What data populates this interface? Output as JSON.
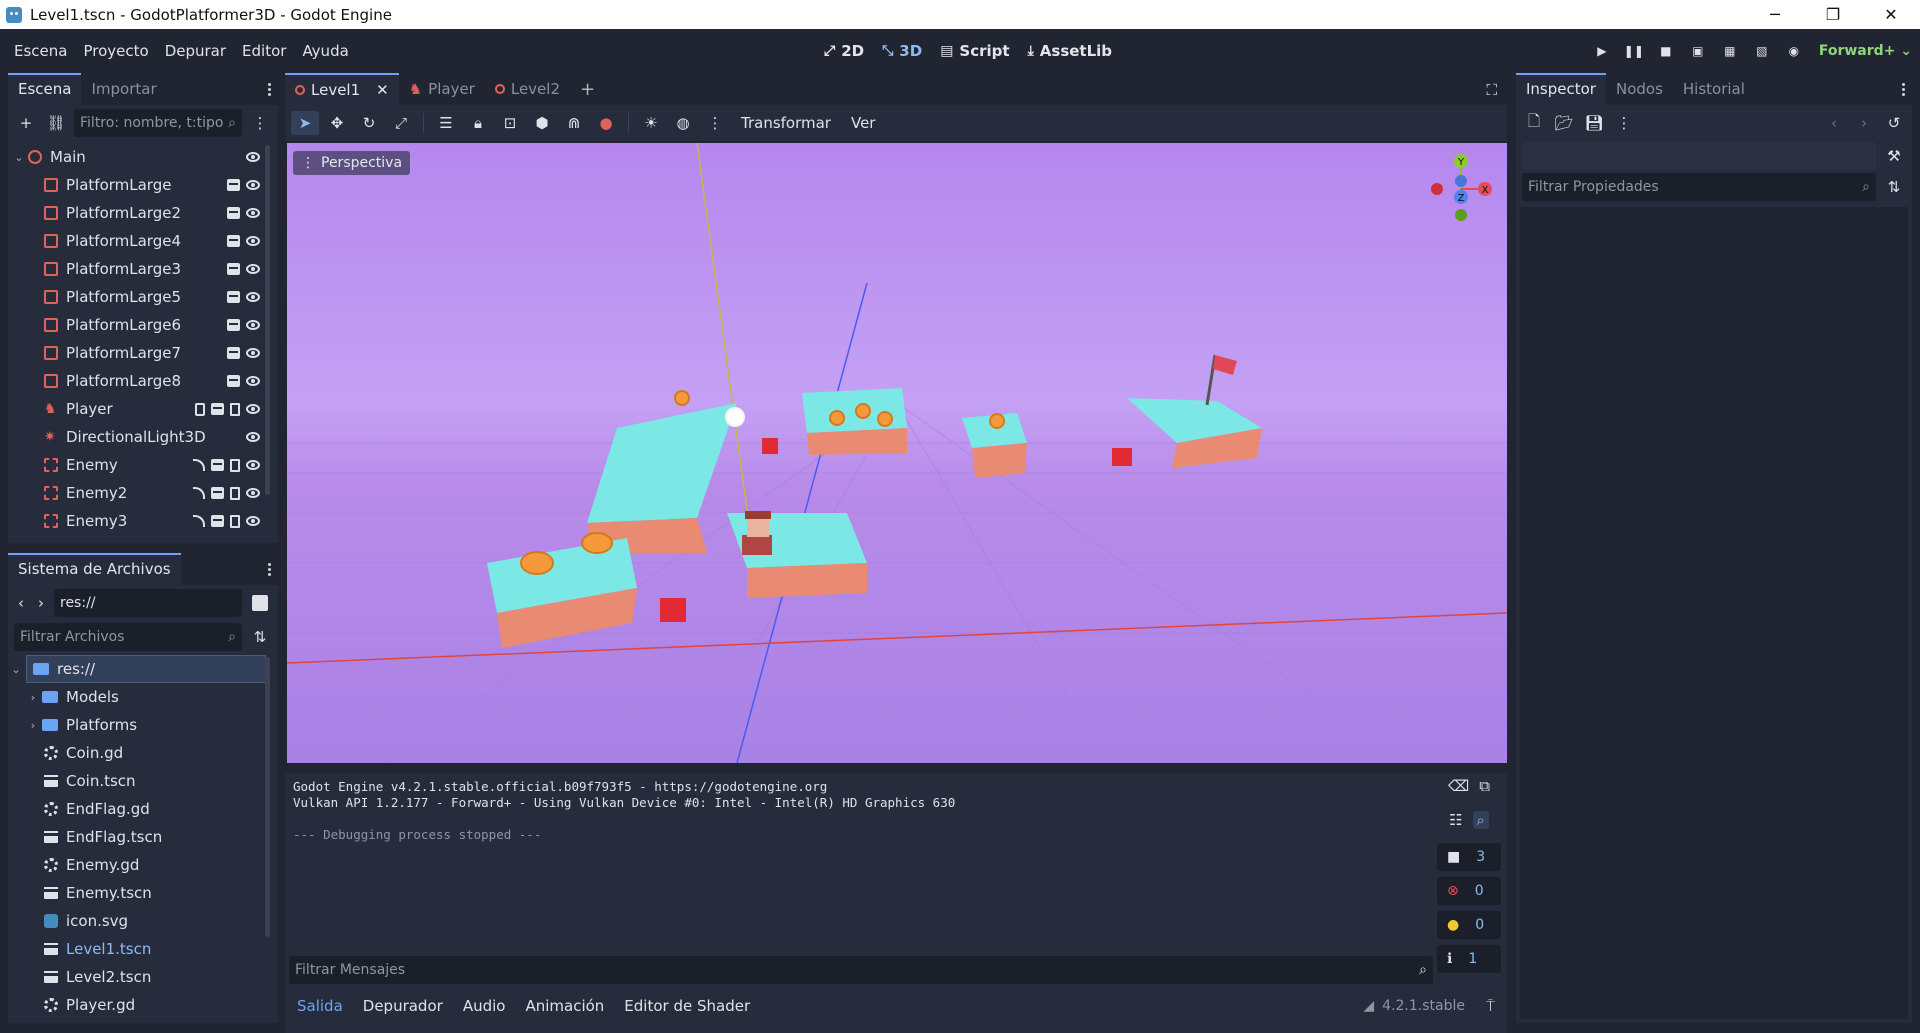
{
  "window": {
    "title": "Level1.tscn - GodotPlatformer3D - Godot Engine",
    "min": "─",
    "max": "❐",
    "close": "✕"
  },
  "menu": [
    "Escena",
    "Proyecto",
    "Depurar",
    "Editor",
    "Ayuda"
  ],
  "workspaces": [
    {
      "label": "2D",
      "icon": "⤢"
    },
    {
      "label": "3D",
      "icon": "⤡"
    },
    {
      "label": "Script",
      "icon": "▤"
    },
    {
      "label": "AssetLib",
      "icon": "⤓"
    }
  ],
  "renderer": "Forward+ ⌄",
  "scene_dock": {
    "tabs": [
      "Escena",
      "Importar"
    ],
    "filter_placeholder": "Filtro: nombre, t:tipo",
    "nodes": [
      {
        "name": "Main",
        "type": "root"
      },
      {
        "name": "PlatformLarge",
        "type": "instance"
      },
      {
        "name": "PlatformLarge2",
        "type": "instance"
      },
      {
        "name": "PlatformLarge4",
        "type": "instance"
      },
      {
        "name": "PlatformLarge3",
        "type": "instance"
      },
      {
        "name": "PlatformLarge5",
        "type": "instance"
      },
      {
        "name": "PlatformLarge6",
        "type": "instance"
      },
      {
        "name": "PlatformLarge7",
        "type": "instance"
      },
      {
        "name": "PlatformLarge8",
        "type": "instance"
      },
      {
        "name": "Player",
        "type": "player"
      },
      {
        "name": "DirectionalLight3D",
        "type": "light"
      },
      {
        "name": "Enemy",
        "type": "enemy"
      },
      {
        "name": "Enemy2",
        "type": "enemy"
      },
      {
        "name": "Enemy3",
        "type": "enemy"
      }
    ]
  },
  "fs_dock": {
    "title": "Sistema de Archivos",
    "path": "res://",
    "filter_placeholder": "Filtrar Archivos",
    "items": [
      {
        "name": "res://",
        "kind": "root"
      },
      {
        "name": "Models",
        "kind": "folder"
      },
      {
        "name": "Platforms",
        "kind": "folder"
      },
      {
        "name": "Coin.gd",
        "kind": "script"
      },
      {
        "name": "Coin.tscn",
        "kind": "scene"
      },
      {
        "name": "EndFlag.gd",
        "kind": "script"
      },
      {
        "name": "EndFlag.tscn",
        "kind": "scene"
      },
      {
        "name": "Enemy.gd",
        "kind": "script"
      },
      {
        "name": "Enemy.tscn",
        "kind": "scene"
      },
      {
        "name": "icon.svg",
        "kind": "svg"
      },
      {
        "name": "Level1.tscn",
        "kind": "scene-active"
      },
      {
        "name": "Level2.tscn",
        "kind": "scene"
      },
      {
        "name": "Player.gd",
        "kind": "script"
      }
    ]
  },
  "scene_tabs": [
    "Level1",
    "Player",
    "Level2"
  ],
  "viewport": {
    "toolbar_labels": [
      "Transformar",
      "Ver"
    ],
    "perspective": "Perspectiva",
    "gizmo": {
      "y": "Y",
      "x": "X",
      "z": "Z"
    },
    "colors": {
      "sky": "#b587ee",
      "platform_top": "#7be8e6",
      "platform_side": "#e98a72"
    }
  },
  "console": {
    "lines": [
      "Godot Engine v4.2.1.stable.official.b09f793f5 - https://godotengine.org",
      "Vulkan API 1.2.177 - Forward+ - Using Vulkan Device #0: Intel - Intel(R) HD Graphics 630",
      "",
      "--- Debugging process stopped ---"
    ],
    "filter_placeholder": "Filtrar Mensajes",
    "counts": {
      "messages": "3",
      "errors": "0",
      "warnings": "0",
      "info": "1"
    },
    "bottom_tabs": [
      "Salida",
      "Depurador",
      "Audio",
      "Animación",
      "Editor de Shader"
    ],
    "version": "4.2.1.stable"
  },
  "inspector": {
    "tabs": [
      "Inspector",
      "Nodos",
      "Historial"
    ],
    "filter_placeholder": "Filtrar Propiedades"
  }
}
